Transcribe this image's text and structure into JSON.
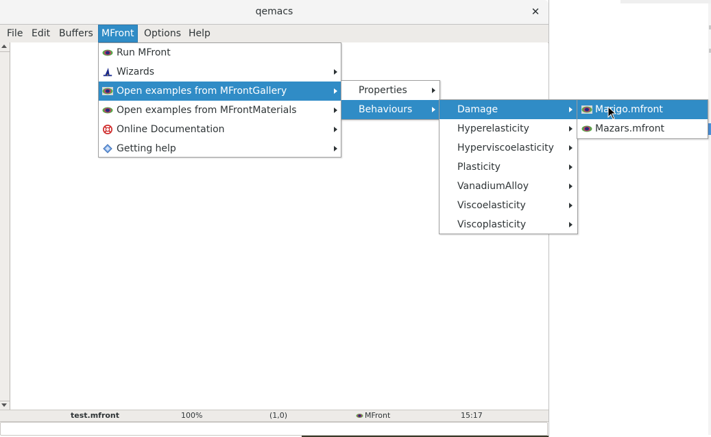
{
  "window": {
    "title": "qemacs",
    "close_icon": "close-icon"
  },
  "menubar": {
    "items": [
      {
        "label": "File"
      },
      {
        "label": "Edit"
      },
      {
        "label": "Buffers"
      },
      {
        "label": "MFront",
        "active": true
      },
      {
        "label": "Options"
      },
      {
        "label": "Help"
      }
    ]
  },
  "menus": {
    "mfront": {
      "items": [
        {
          "label": "Run MFront",
          "icon": "mfront-eye-icon",
          "submenu": false
        },
        {
          "label": "Wizards",
          "icon": "wizard-hat-icon",
          "submenu": true
        },
        {
          "label": "Open examples from MFrontGallery",
          "icon": "mfront-eye-icon",
          "submenu": true,
          "highlighted": true
        },
        {
          "label": "Open examples from MFrontMaterials",
          "icon": "mfront-eye-icon",
          "submenu": true
        },
        {
          "label": "Online Documentation",
          "icon": "lifebuoy-icon",
          "submenu": true
        },
        {
          "label": "Getting help",
          "icon": "help-diamond-icon",
          "submenu": true
        }
      ]
    },
    "gallery": {
      "items": [
        {
          "label": "Properties",
          "submenu": true
        },
        {
          "label": "Behaviours",
          "submenu": true,
          "highlighted": true
        }
      ]
    },
    "behaviours": {
      "items": [
        {
          "label": "Damage",
          "submenu": true,
          "highlighted": true
        },
        {
          "label": "Hyperelasticity",
          "submenu": true
        },
        {
          "label": "Hyperviscoelasticity",
          "submenu": true
        },
        {
          "label": "Plasticity",
          "submenu": true
        },
        {
          "label": "VanadiumAlloy",
          "submenu": true
        },
        {
          "label": "Viscoelasticity",
          "submenu": true
        },
        {
          "label": "Viscoplasticity",
          "submenu": true
        }
      ]
    },
    "damage": {
      "items": [
        {
          "label": "Marigo.mfront",
          "icon": "mfront-eye-icon",
          "highlighted": true
        },
        {
          "label": "Mazars.mfront",
          "icon": "mfront-eye-icon"
        }
      ]
    }
  },
  "statusbar": {
    "filename": "test.mfront",
    "zoom": "100%",
    "position": "(1,0)",
    "mode": "MFront",
    "mode_icon": "mfront-eye-icon",
    "time": "15:17"
  },
  "minibuffer": {
    "value": ""
  },
  "colors": {
    "highlight": "#308cc6",
    "menubar_bg": "#edebe8",
    "titlebar_bg": "#f4f4f4"
  }
}
